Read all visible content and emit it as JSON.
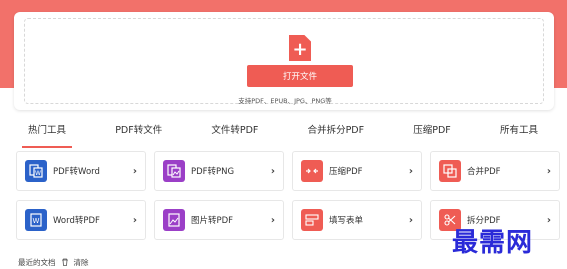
{
  "upload": {
    "button_label": "打开文件",
    "support_text": "支持PDF、EPUB、JPG、PNG等",
    "plus_symbol": "+"
  },
  "tabs": [
    {
      "label": "热门工具",
      "active": true
    },
    {
      "label": "PDF转文件",
      "active": false
    },
    {
      "label": "文件转PDF",
      "active": false
    },
    {
      "label": "合并拆分PDF",
      "active": false
    },
    {
      "label": "压缩PDF",
      "active": false
    },
    {
      "label": "所有工具",
      "active": false
    }
  ],
  "tools": [
    {
      "label": "PDF转Word",
      "icon": "pdf-to-word-icon",
      "color": "#2b62c9"
    },
    {
      "label": "PDF转PNG",
      "icon": "pdf-to-png-icon",
      "color": "#9b3fc7"
    },
    {
      "label": "压缩PDF",
      "icon": "compress-pdf-icon",
      "color": "#ef5c54"
    },
    {
      "label": "合并PDF",
      "icon": "merge-pdf-icon",
      "color": "#ef5c54"
    },
    {
      "label": "Word转PDF",
      "icon": "word-to-pdf-icon",
      "color": "#2b62c9"
    },
    {
      "label": "图片转PDF",
      "icon": "image-to-pdf-icon",
      "color": "#9b3fc7"
    },
    {
      "label": "填写表单",
      "icon": "fill-form-icon",
      "color": "#ef5c54"
    },
    {
      "label": "拆分PDF",
      "icon": "split-pdf-icon",
      "color": "#ef5c54"
    }
  ],
  "recent": {
    "label": "最近的文档",
    "clear_label": "清除"
  },
  "watermark": "最需网",
  "colors": {
    "accent": "#ef5c54",
    "hero": "#f2716a"
  }
}
